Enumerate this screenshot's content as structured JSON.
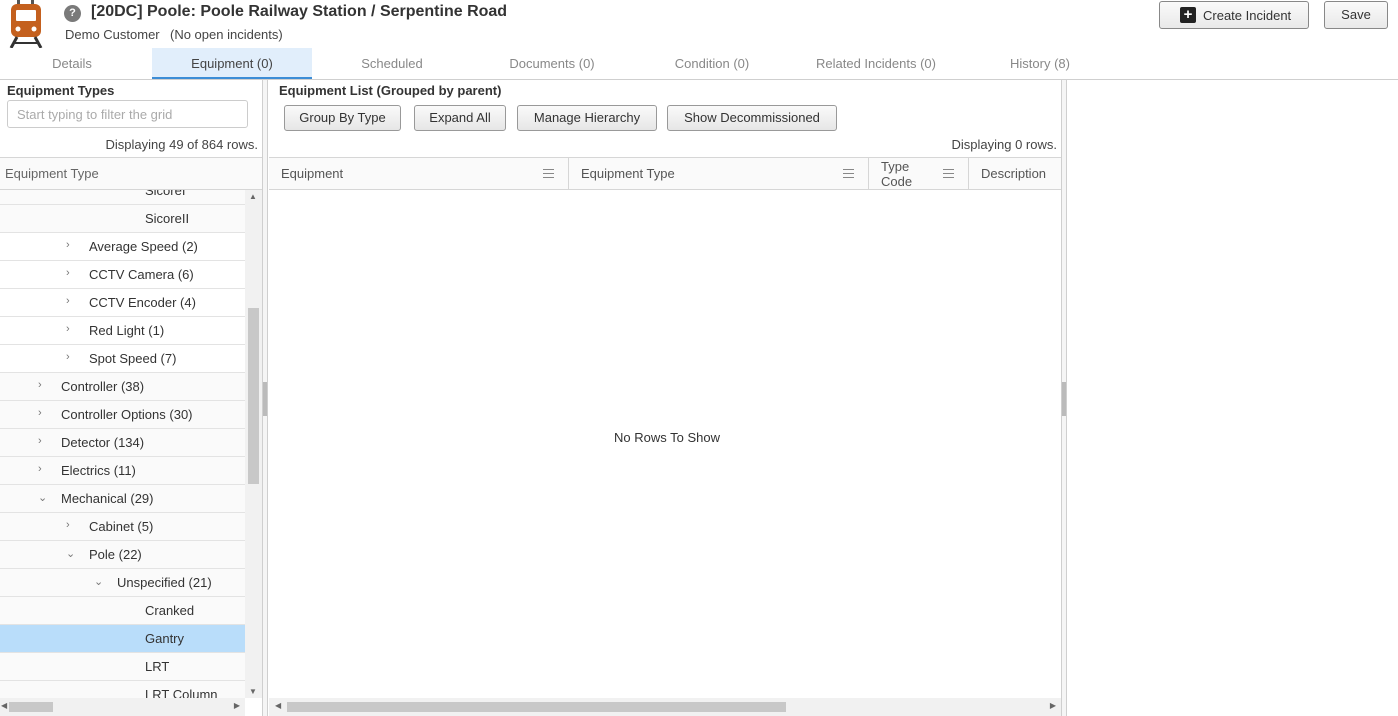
{
  "header": {
    "title": "[20DC] Poole: Poole Railway Station / Serpentine Road",
    "customer": "Demo Customer",
    "incidents_status": "(No open incidents)",
    "help_glyph": "?",
    "create_incident_label": "Create Incident",
    "save_label": "Save",
    "accent_color": "#c4601e"
  },
  "tabs": [
    {
      "label": "Details"
    },
    {
      "label": "Equipment (0)",
      "active": true
    },
    {
      "label": "Scheduled"
    },
    {
      "label": "Documents (0)"
    },
    {
      "label": "Condition (0)"
    },
    {
      "label": "Related Incidents (0)"
    },
    {
      "label": "History (8)"
    }
  ],
  "equipment_types": {
    "title": "Equipment Types",
    "filter_placeholder": "Start typing to filter the grid",
    "count_text": "Displaying 49 of 864 rows.",
    "column_header": "Equipment Type",
    "rows": [
      {
        "label": "SicoreI"
      },
      {
        "label": "SicoreII"
      },
      {
        "label": "Average Speed  (2)",
        "chevron": "›"
      },
      {
        "label": "CCTV Camera  (6)",
        "chevron": "›"
      },
      {
        "label": "CCTV Encoder  (4)",
        "chevron": "›"
      },
      {
        "label": "Red Light  (1)",
        "chevron": "›"
      },
      {
        "label": "Spot Speed  (7)",
        "chevron": "›"
      },
      {
        "label": "Controller  (38)",
        "chevron": "›"
      },
      {
        "label": "Controller Options  (30)",
        "chevron": "›"
      },
      {
        "label": "Detector  (134)",
        "chevron": "›"
      },
      {
        "label": "Electrics  (11)",
        "chevron": "›"
      },
      {
        "label": "Mechanical  (29)",
        "chevron": "⌄"
      },
      {
        "label": "Cabinet  (5)",
        "chevron": "›"
      },
      {
        "label": "Pole  (22)",
        "chevron": "⌄"
      },
      {
        "label": "Unspecified  (21)",
        "chevron": "⌄"
      },
      {
        "label": "Cranked"
      },
      {
        "label": "Gantry",
        "selected": true
      },
      {
        "label": "LRT"
      },
      {
        "label": "LRT Column"
      }
    ]
  },
  "equipment_list": {
    "title": "Equipment List (Grouped by parent)",
    "buttons": {
      "group_by_type": "Group By Type",
      "expand_all": "Expand All",
      "manage_hierarchy": "Manage Hierarchy",
      "show_decommissioned": "Show Decommissioned"
    },
    "count_text": "Displaying 0 rows.",
    "columns": {
      "equipment": "Equipment",
      "equipment_type": "Equipment Type",
      "type_code_line1": "Type",
      "type_code_line2": "Code",
      "description": "Description"
    },
    "empty_message": "No Rows To Show"
  }
}
